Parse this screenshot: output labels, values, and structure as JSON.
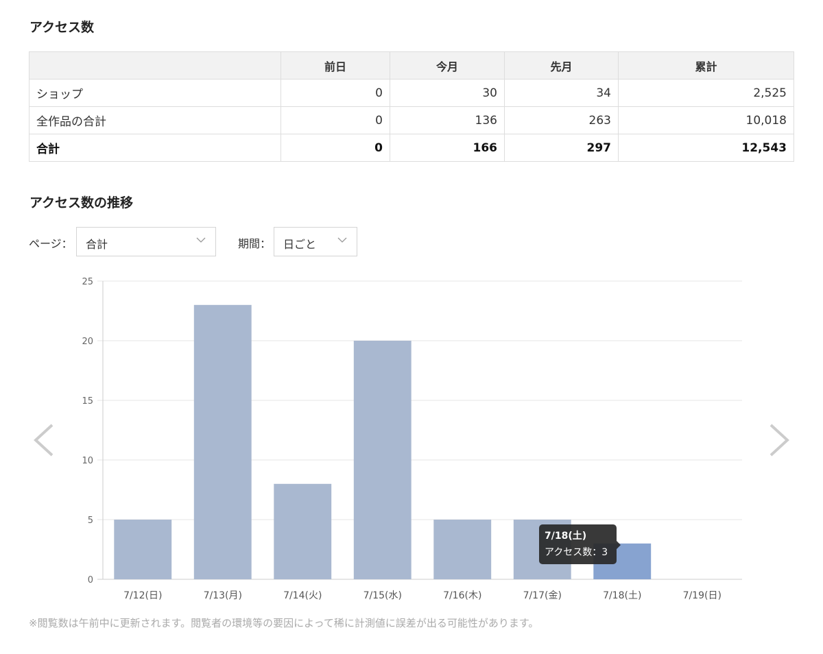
{
  "section1": {
    "title": "アクセス数"
  },
  "stats_table": {
    "headers": [
      "",
      "前日",
      "今月",
      "先月",
      "累計"
    ],
    "rows": [
      {
        "label": "ショップ",
        "values": [
          "0",
          "30",
          "34",
          "2,525"
        ]
      },
      {
        "label": "全作品の合計",
        "values": [
          "0",
          "136",
          "263",
          "10,018"
        ]
      },
      {
        "label": "合計",
        "values": [
          "0",
          "166",
          "297",
          "12,543"
        ]
      }
    ]
  },
  "section2": {
    "title": "アクセス数の推移"
  },
  "filters": {
    "page_label": "ページ：",
    "page_value": "合計",
    "period_label": "期間：",
    "period_value": "日ごと"
  },
  "chart_data": {
    "type": "bar",
    "categories": [
      "7/12(日)",
      "7/13(月)",
      "7/14(火)",
      "7/15(水)",
      "7/16(木)",
      "7/17(金)",
      "7/18(土)",
      "7/19(日)"
    ],
    "values": [
      5,
      23,
      8,
      20,
      5,
      5,
      3,
      0
    ],
    "yticks": [
      0,
      5,
      10,
      15,
      20,
      25
    ],
    "ylim": [
      0,
      25
    ],
    "grid": true,
    "highlighted_index": 6,
    "bar_color": "#a9b8d0",
    "highlight_color": "#87a3d0"
  },
  "tooltip": {
    "date": "7/18(土)",
    "text": "アクセス数：3"
  },
  "note": "※閲覧数は午前中に更新されます。閲覧者の環境等の要因によって稀に計測値に誤差が出る可能性があります。"
}
